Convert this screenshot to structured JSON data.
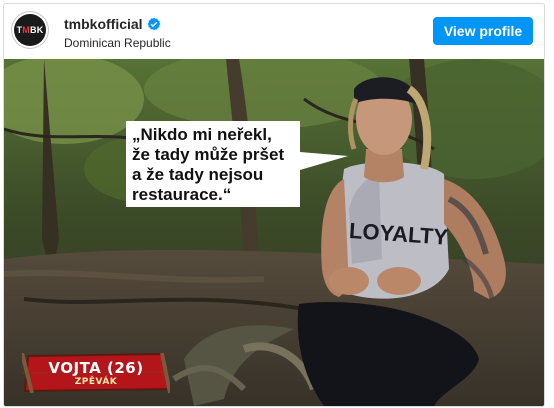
{
  "header": {
    "avatar_text_pre": "T",
    "avatar_text_accent": "M",
    "avatar_text_post": "BK",
    "username": "tmbkofficial",
    "location": "Dominican Republic",
    "view_profile_label": "View profile",
    "button_color": "#0095f6",
    "verified_icon": "verified-badge-icon"
  },
  "post": {
    "quote_lines": [
      "„Nikdo mi neřekl,",
      "že tady může pršet",
      "a že tady nejsou",
      "restaurace.“"
    ],
    "nameplate": {
      "name": "VOJTA (26)",
      "role": "ZPĚVÁK",
      "color": "#b3151a"
    }
  }
}
